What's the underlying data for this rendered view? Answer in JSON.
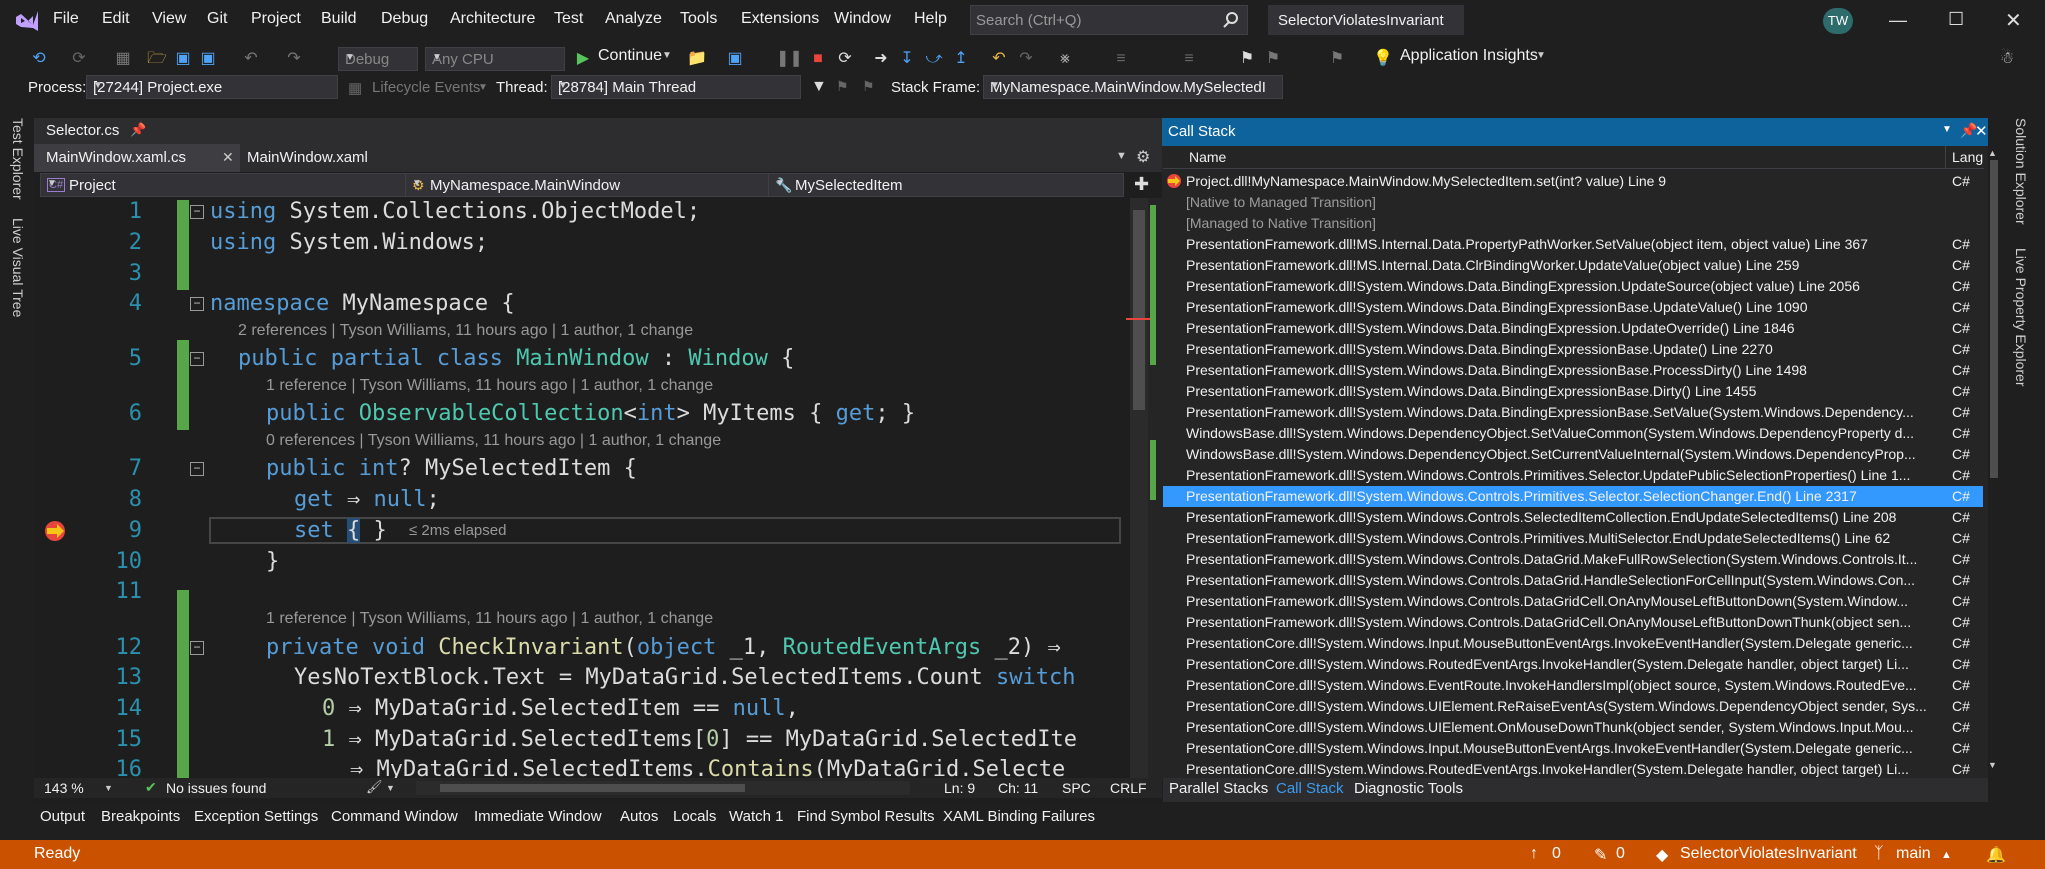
{
  "menu": [
    "File",
    "Edit",
    "View",
    "Git",
    "Project",
    "Build",
    "Debug",
    "Architecture",
    "Test",
    "Analyze",
    "Tools",
    "Extensions",
    "Window",
    "Help"
  ],
  "search": {
    "placeholder": "Search (Ctrl+Q)"
  },
  "solution_name": "SelectorViolatesInvariant",
  "user_initials": "TW",
  "toolbar": {
    "config": "Debug",
    "platform": "Any CPU",
    "continue_label": "Continue",
    "app_insights": "Application Insights"
  },
  "debug_location": {
    "process_label": "Process:",
    "process_value": "[27244] Project.exe",
    "lifecycle_label": "Lifecycle Events",
    "thread_label": "Thread:",
    "thread_value": "[28784] Main Thread",
    "stackframe_label": "Stack Frame:",
    "stackframe_value": "MyNamespace.MainWindow.MySelectedI"
  },
  "left_tabs": [
    "Test Explorer",
    "Live Visual Tree"
  ],
  "right_tabs": [
    "Solution Explorer",
    "Live Property Explorer"
  ],
  "editor": {
    "pinned_tab": "Selector.cs",
    "tabs": [
      "MainWindow.xaml.cs",
      "MainWindow.xaml"
    ],
    "nav_project": "Project",
    "nav_type": "MyNamespace.MainWindow",
    "nav_member": "MySelectedItem",
    "line_numbers": [
      "1",
      "2",
      "3",
      "4",
      "5",
      "6",
      "7",
      "8",
      "9",
      "10",
      "11",
      "12",
      "13",
      "14",
      "15",
      "16"
    ],
    "codelens": {
      "l5": "2 references | Tyson Williams, 11 hours ago | 1 author, 1 change",
      "l6": "1 reference | Tyson Williams, 11 hours ago | 1 author, 1 change",
      "l7": "0 references | Tyson Williams, 11 hours ago | 1 author, 1 change",
      "l12": "1 reference | Tyson Williams, 11 hours ago | 1 author, 1 change"
    },
    "elapsed": "≤ 2ms elapsed",
    "zoom": "143 %",
    "issues": "No issues found",
    "ln": "Ln: 9",
    "ch": "Ch: 11",
    "spc": "SPC",
    "crlf": "CRLF"
  },
  "call_stack": {
    "title": "Call Stack",
    "col_name": "Name",
    "col_lang": "Lang",
    "frames": [
      {
        "name": "Project.dll!MyNamespace.MainWindow.MySelectedItem.set(int? value) Line 9",
        "lang": "C#"
      },
      {
        "name": "[Native to Managed Transition]",
        "lang": ""
      },
      {
        "name": "[Managed to Native Transition]",
        "lang": ""
      },
      {
        "name": "PresentationFramework.dll!MS.Internal.Data.PropertyPathWorker.SetValue(object item, object value) Line 367",
        "lang": "C#"
      },
      {
        "name": "PresentationFramework.dll!MS.Internal.Data.ClrBindingWorker.UpdateValue(object value) Line 259",
        "lang": "C#"
      },
      {
        "name": "PresentationFramework.dll!System.Windows.Data.BindingExpression.UpdateSource(object value) Line 2056",
        "lang": "C#"
      },
      {
        "name": "PresentationFramework.dll!System.Windows.Data.BindingExpressionBase.UpdateValue() Line 1090",
        "lang": "C#"
      },
      {
        "name": "PresentationFramework.dll!System.Windows.Data.BindingExpression.UpdateOverride() Line 1846",
        "lang": "C#"
      },
      {
        "name": "PresentationFramework.dll!System.Windows.Data.BindingExpressionBase.Update() Line 2270",
        "lang": "C#"
      },
      {
        "name": "PresentationFramework.dll!System.Windows.Data.BindingExpressionBase.ProcessDirty() Line 1498",
        "lang": "C#"
      },
      {
        "name": "PresentationFramework.dll!System.Windows.Data.BindingExpressionBase.Dirty() Line 1455",
        "lang": "C#"
      },
      {
        "name": "PresentationFramework.dll!System.Windows.Data.BindingExpressionBase.SetValue(System.Windows.Dependency...",
        "lang": "C#"
      },
      {
        "name": "WindowsBase.dll!System.Windows.DependencyObject.SetValueCommon(System.Windows.DependencyProperty d...",
        "lang": "C#"
      },
      {
        "name": "WindowsBase.dll!System.Windows.DependencyObject.SetCurrentValueInternal(System.Windows.DependencyProp...",
        "lang": "C#"
      },
      {
        "name": "PresentationFramework.dll!System.Windows.Controls.Primitives.Selector.UpdatePublicSelectionProperties() Line 1...",
        "lang": "C#"
      },
      {
        "name": "PresentationFramework.dll!System.Windows.Controls.Primitives.Selector.SelectionChanger.End() Line 2317",
        "lang": "C#"
      },
      {
        "name": "PresentationFramework.dll!System.Windows.Controls.SelectedItemCollection.EndUpdateSelectedItems() Line 208",
        "lang": "C#"
      },
      {
        "name": "PresentationFramework.dll!System.Windows.Controls.Primitives.MultiSelector.EndUpdateSelectedItems() Line 62",
        "lang": "C#"
      },
      {
        "name": "PresentationFramework.dll!System.Windows.Controls.DataGrid.MakeFullRowSelection(System.Windows.Controls.It...",
        "lang": "C#"
      },
      {
        "name": "PresentationFramework.dll!System.Windows.Controls.DataGrid.HandleSelectionForCellInput(System.Windows.Con...",
        "lang": "C#"
      },
      {
        "name": "PresentationFramework.dll!System.Windows.Controls.DataGridCell.OnAnyMouseLeftButtonDown(System.Window...",
        "lang": "C#"
      },
      {
        "name": "PresentationFramework.dll!System.Windows.Controls.DataGridCell.OnAnyMouseLeftButtonDownThunk(object sen...",
        "lang": "C#"
      },
      {
        "name": "PresentationCore.dll!System.Windows.Input.MouseButtonEventArgs.InvokeEventHandler(System.Delegate generic...",
        "lang": "C#"
      },
      {
        "name": "PresentationCore.dll!System.Windows.RoutedEventArgs.InvokeHandler(System.Delegate handler, object target) Li...",
        "lang": "C#"
      },
      {
        "name": "PresentationCore.dll!System.Windows.EventRoute.InvokeHandlersImpl(object source, System.Windows.RoutedEve...",
        "lang": "C#"
      },
      {
        "name": "PresentationCore.dll!System.Windows.UIElement.ReRaiseEventAs(System.Windows.DependencyObject sender, Sys...",
        "lang": "C#"
      },
      {
        "name": "PresentationCore.dll!System.Windows.UIElement.OnMouseDownThunk(object sender, System.Windows.Input.Mou...",
        "lang": "C#"
      },
      {
        "name": "PresentationCore.dll!System.Windows.Input.MouseButtonEventArgs.InvokeEventHandler(System.Delegate generic...",
        "lang": "C#"
      },
      {
        "name": "PresentationCore.dll!System.Windows.RoutedEventArgs.InvokeHandler(System.Delegate handler, object target) Li...",
        "lang": "C#"
      }
    ],
    "selected_index": 15
  },
  "right_bottom_tabs": [
    "Parallel Stacks",
    "Call Stack",
    "Diagnostic Tools"
  ],
  "bottom_tabs": [
    "Output",
    "Breakpoints",
    "Exception Settings",
    "Command Window",
    "Immediate Window",
    "Autos",
    "Locals",
    "Watch 1",
    "Find Symbol Results",
    "XAML Binding Failures"
  ],
  "status": {
    "ready": "Ready",
    "up_count": "0",
    "edit_count": "0",
    "solution": "SelectorViolatesInvariant",
    "branch": "main"
  },
  "colors": {
    "accent": "#0e639c",
    "status_bar": "#ca5100",
    "selection": "#3399ff"
  }
}
